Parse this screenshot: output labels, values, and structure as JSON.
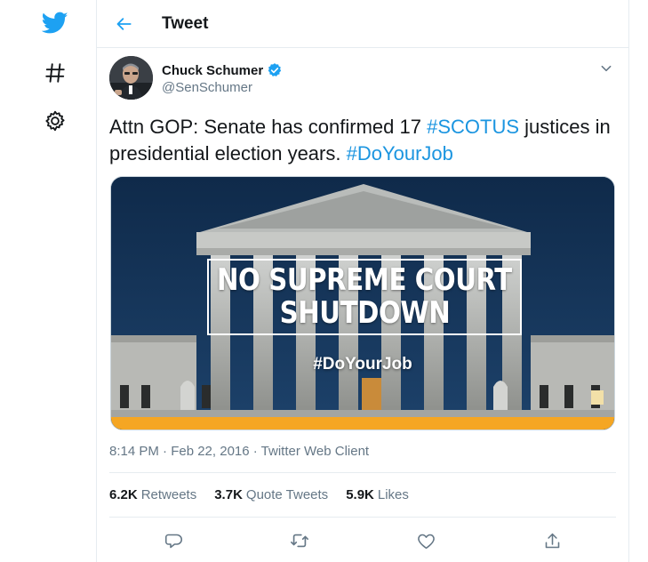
{
  "nav": {
    "items": [
      {
        "icon": "twitter-bird-icon"
      },
      {
        "icon": "hashtag-icon"
      },
      {
        "icon": "gear-icon"
      }
    ]
  },
  "header": {
    "title": "Tweet",
    "back_icon": "arrow-left-icon"
  },
  "tweet": {
    "author": {
      "name": "Chuck Schumer",
      "handle": "@SenSchumer",
      "verified": true
    },
    "text": {
      "part1": "Attn GOP: Senate has confirmed 17 ",
      "hashtag1": "#SCOTUS",
      "part2": " justices in presidential election years. ",
      "hashtag2": "#DoYourJob"
    },
    "media": {
      "banner_line1": "NO SUPREME COURT",
      "banner_line2": "SHUTDOWN",
      "hashtag": "#DoYourJob"
    },
    "timestamp": "8:14 PM · Feb 22, 2016",
    "separator": " · ",
    "client": "Twitter Web Client",
    "stats": [
      {
        "count": "6.2K",
        "label": "Retweets"
      },
      {
        "count": "3.7K",
        "label": "Quote Tweets"
      },
      {
        "count": "5.9K",
        "label": "Likes"
      }
    ],
    "actions": [
      "reply-icon",
      "retweet-icon",
      "like-icon",
      "share-icon"
    ]
  },
  "colors": {
    "accent": "#1da1f2",
    "hashtag": "#1b95e0",
    "verified": "#1da1f2",
    "secondary_text": "#657786",
    "media_stripe": "#f5a623"
  }
}
